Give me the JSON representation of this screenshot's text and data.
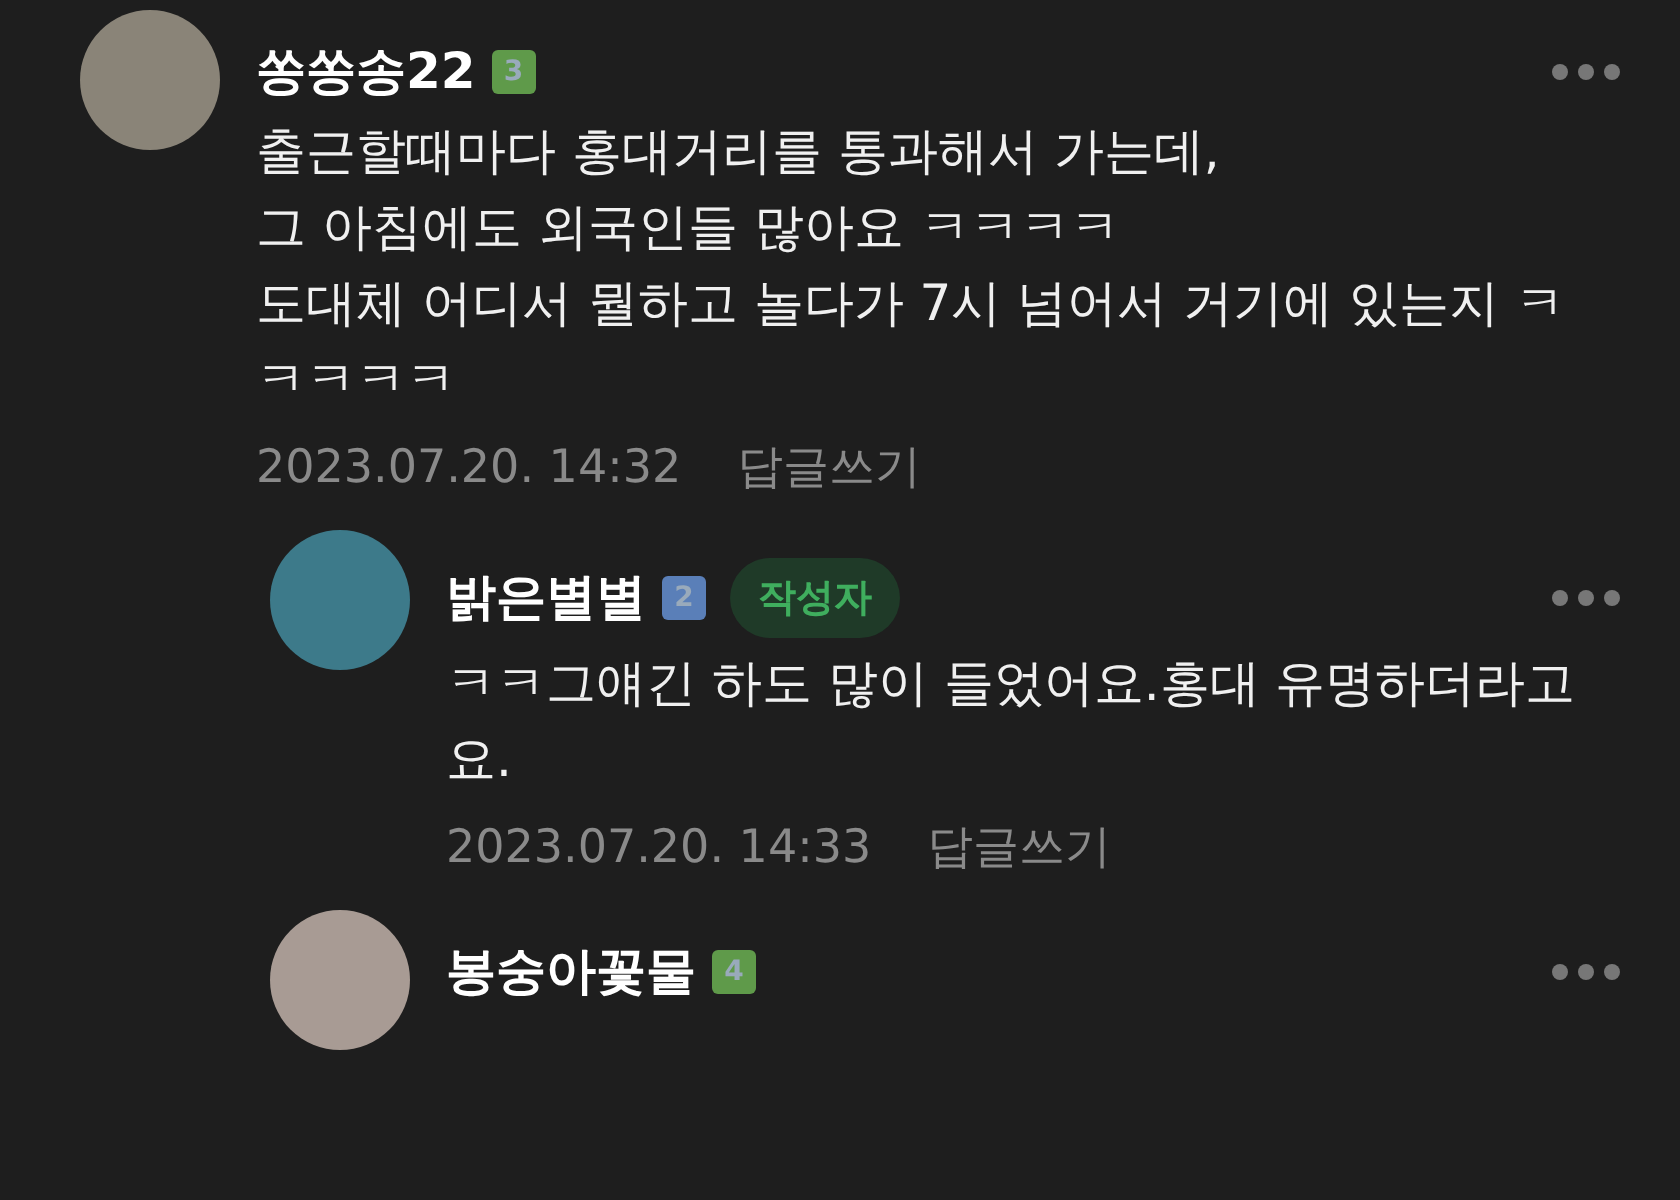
{
  "comments": [
    {
      "author": "쏭쏭송22",
      "level": "3",
      "color": "#5f9a4a",
      "is_author": false,
      "text": "출근할때마다 홍대거리를 통과해서 가는데,\n그 아침에도 외국인들 많아요 ㅋㅋㅋㅋ\n도대체 어디서 뭘하고 놀다가 7시 넘어서 거기에 있는지 ㅋㅋㅋㅋㅋ",
      "date": "2023.07.20. 14:32",
      "reply": "답글쓰기",
      "children": [
        {
          "author": "밝은별별",
          "level": "2",
          "color": "#5a7fb8",
          "is_author": true,
          "author_tag": "작성자",
          "text": "ㅋㅋ그얘긴 하도 많이 들었어요.홍대 유명하더라고요.",
          "date": "2023.07.20. 14:33",
          "reply": "답글쓰기"
        },
        {
          "author": "봉숭아꽃물",
          "level": "4",
          "color": "#5f9a4a",
          "is_author": false
        }
      ]
    }
  ]
}
